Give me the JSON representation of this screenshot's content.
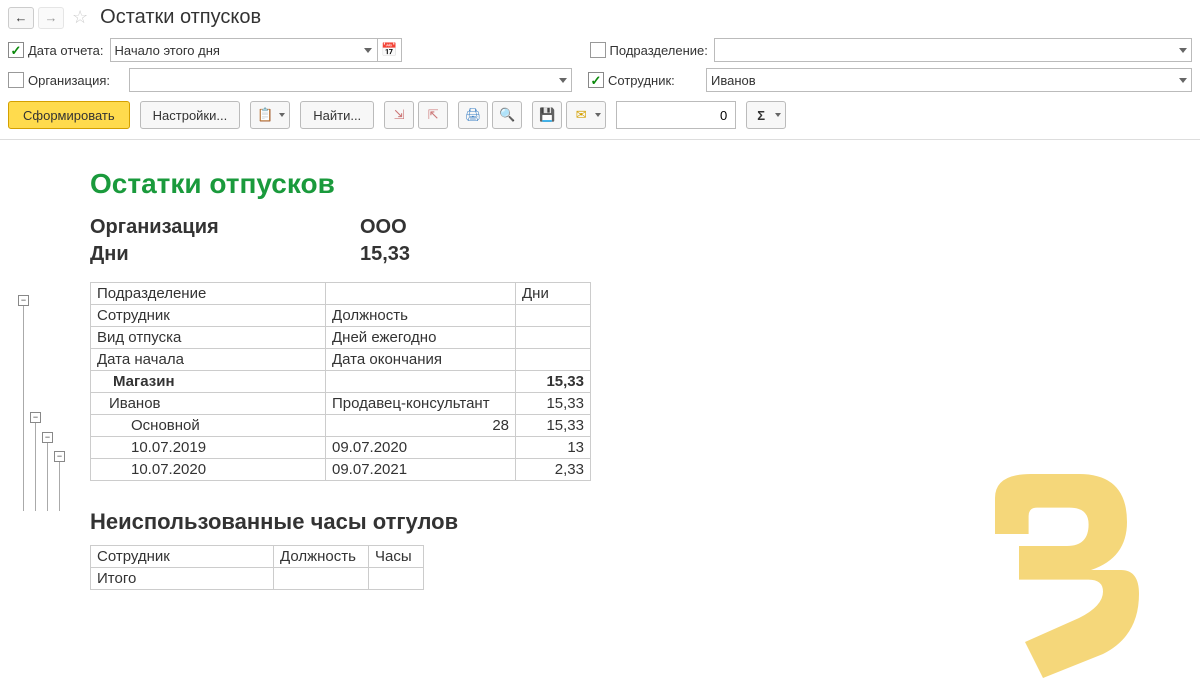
{
  "header": {
    "title": "Остатки отпусков"
  },
  "filters": {
    "date": {
      "label": "Дата отчета:",
      "value": "Начало этого дня"
    },
    "department": {
      "label": "Подразделение:"
    },
    "org": {
      "label": "Организация:"
    },
    "employee": {
      "label": "Сотрудник:",
      "value": "Иванов"
    }
  },
  "toolbar": {
    "generate": "Сформировать",
    "settings": "Настройки...",
    "find": "Найти...",
    "num": "0",
    "sigma": "Σ"
  },
  "report": {
    "title": "Остатки отпусков",
    "summary": [
      {
        "label": "Организация",
        "value": "ООО"
      },
      {
        "label": "Дни",
        "value": "15,33"
      }
    ],
    "cols": {
      "c1a": "Подразделение",
      "c1b": "Дни",
      "c2a": "Сотрудник",
      "c2b": "Должность",
      "c3a": "Вид отпуска",
      "c3b": "Дней ежегодно",
      "c4a": "Дата начала",
      "c4b": "Дата окончания"
    },
    "rows": [
      {
        "a": "Магазин",
        "b": "",
        "c": "15,33",
        "cls": "bold",
        "indent": "indent1"
      },
      {
        "a": "Иванов",
        "b": "Продавец-консультант",
        "c": "15,33",
        "indent": "indent2"
      },
      {
        "a": "Основной",
        "b": "28",
        "c": "15,33",
        "indent": "indent3",
        "bnum": true
      },
      {
        "a": "10.07.2019",
        "b": "09.07.2020",
        "c": "13",
        "indent": "indent4"
      },
      {
        "a": "10.07.2020",
        "b": "09.07.2021",
        "c": "2,33",
        "indent": "indent4"
      }
    ],
    "section2": {
      "title": "Неиспользованные часы отгулов",
      "h1": "Сотрудник",
      "h2": "Должность",
      "h3": "Часы",
      "total": "Итого"
    }
  }
}
